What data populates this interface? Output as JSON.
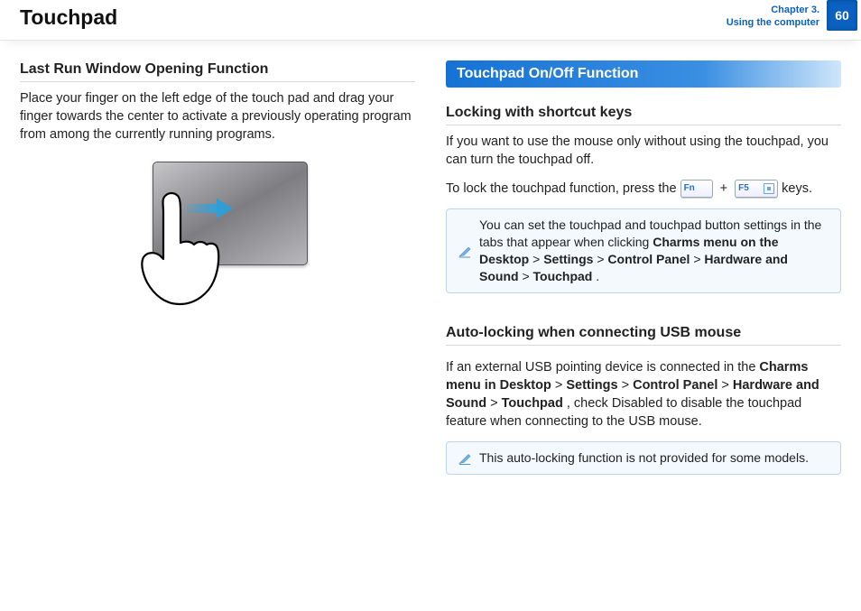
{
  "header": {
    "title": "Touchpad",
    "chapter_line1": "Chapter 3.",
    "chapter_line2": "Using the computer",
    "page_number": "60"
  },
  "left": {
    "h2": "Last Run Window Opening Function",
    "para": "Place your finger on the left edge of the touch pad and drag your finger towards the center to activate a previously operating program from among the currently running programs."
  },
  "right": {
    "section_bar": "Touchpad On/Off Function",
    "lock": {
      "h3": "Locking with shortcut keys",
      "para1": "If you want to use the mouse only without using the touchpad, you can turn the touchpad off.",
      "para2_pre": "To lock the touchpad function, press the ",
      "key_fn": "Fn",
      "plus": "+",
      "key_f5": "F5",
      "para2_post": " keys.",
      "note_pre": "You can set the touchpad and touchpad button settings in the tabs that appear when clicking ",
      "note_path1": "Charms menu on the Desktop",
      "gt": " > ",
      "note_path2": "Settings",
      "note_path3": "Control Panel",
      "note_path4": "Hardware and Sound",
      "note_path5": "Touchpad",
      "note_post": "."
    },
    "auto": {
      "h3": "Auto-locking when connecting USB mouse",
      "para_pre": "If an external USB pointing device is connected in the ",
      "p1": "Charms menu in Desktop",
      "gt": " > ",
      "p2": "Settings",
      "p3": "Control Panel",
      "p4": "Hardware and Sound",
      "p5": "Touchpad",
      "para_post": ", check Disabled to disable the touchpad feature when connecting to the USB mouse.",
      "note": "This auto-locking function is not provided for some models."
    }
  }
}
